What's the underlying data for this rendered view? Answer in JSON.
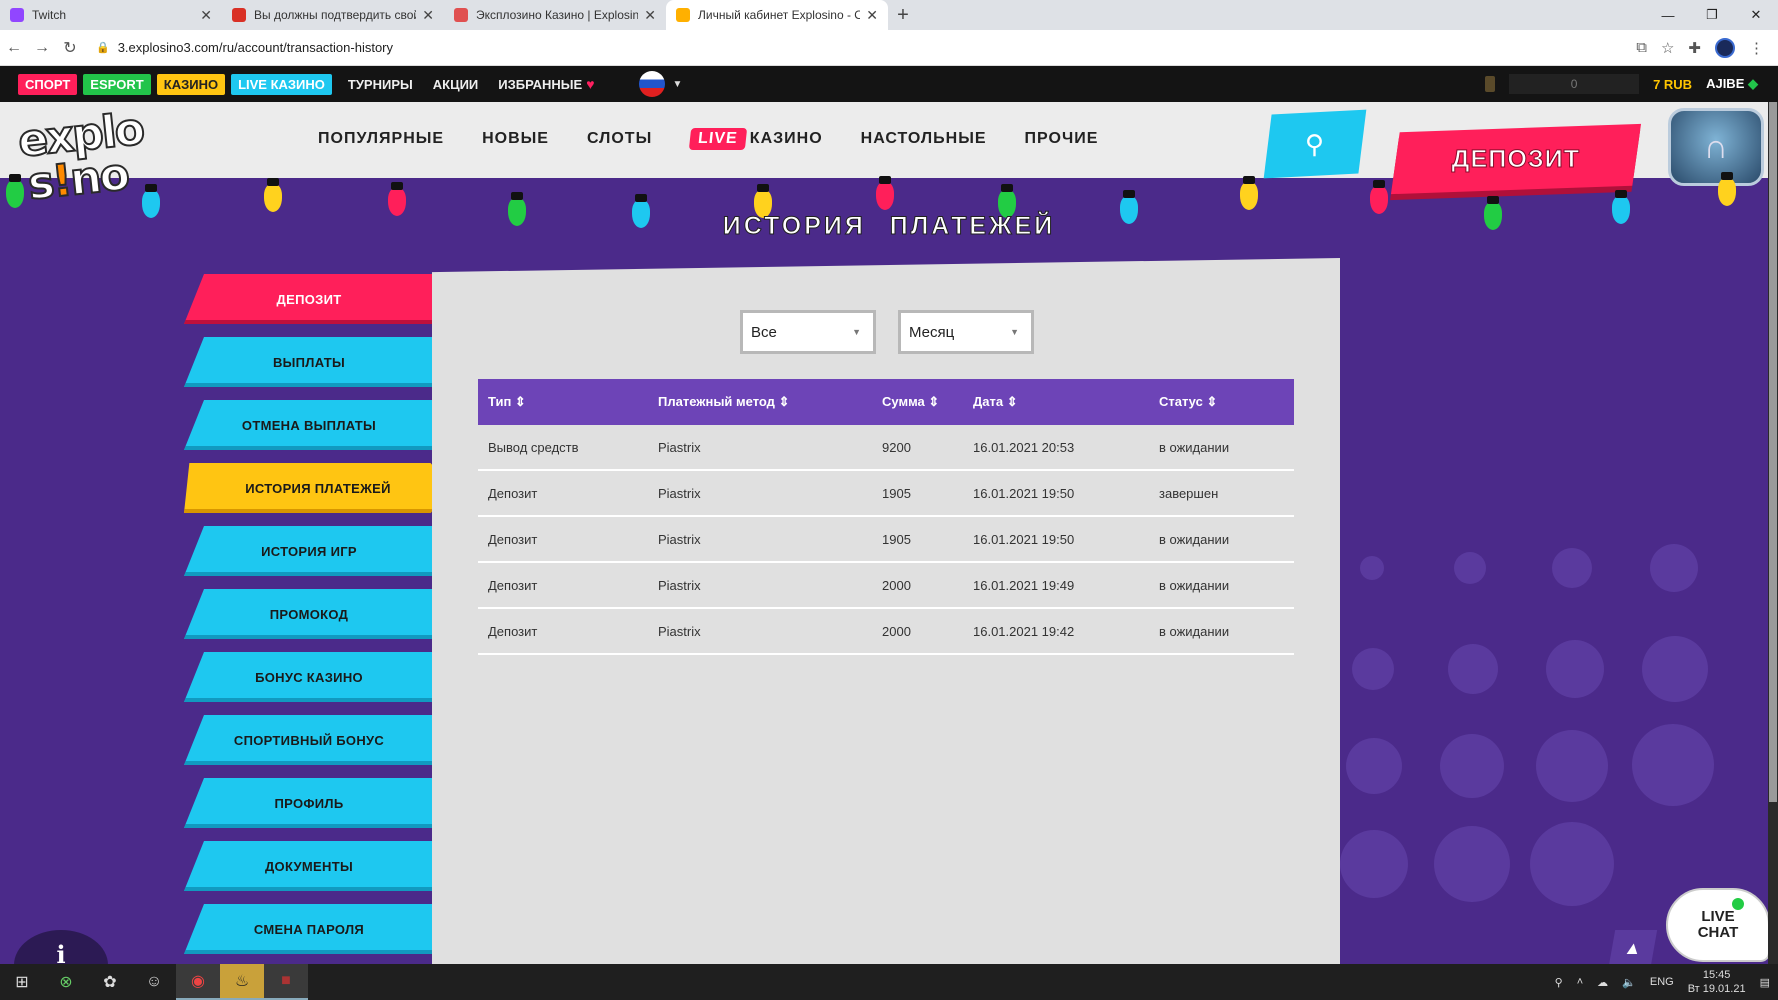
{
  "browser": {
    "tabs": [
      {
        "title": "Twitch",
        "color": "#9146ff",
        "active": false
      },
      {
        "title": "Вы должны подтвердить свой а",
        "color": "#d93025",
        "active": false
      },
      {
        "title": "Эксплозино Казино | Explosino с",
        "color": "#e05050",
        "active": false
      },
      {
        "title": "Личный кабинет Explosino - Onl",
        "color": "#ffb000",
        "active": true
      }
    ],
    "new_tab": "+",
    "url": "3.explosino3.com/ru/account/transaction-history"
  },
  "sitebar": {
    "sport": "СПОРТ",
    "esport": "ESPORT",
    "casino": "КАЗИНО",
    "live_casino": "LIVE КАЗИНО",
    "tournaments": "ТУРНИРЫ",
    "promotions": "АКЦИИ",
    "favorites": "ИЗБРАННЫЕ",
    "balance_box": "0",
    "balance": "7 RUB",
    "user": "AJIBE"
  },
  "header": {
    "logo_top": "explo",
    "logo_bottom_a": "s",
    "logo_bottom_b": "!",
    "logo_bottom_c": "no",
    "nav": {
      "popular": "ПОПУЛЯРНЫЕ",
      "new": "НОВЫЕ",
      "slots": "СЛОТЫ",
      "live_tag": "LIVE",
      "live_casino": "КАЗИНО",
      "table": "НАСТОЛЬНЫЕ",
      "other": "ПРОЧИЕ"
    },
    "deposit_button": "ДЕПОЗИТ"
  },
  "page_title": "ИСТОРИЯ ПЛАТЕЖЕЙ",
  "sidemenu": [
    {
      "label": "ДЕПОЗИТ"
    },
    {
      "label": "ВЫПЛАТЫ"
    },
    {
      "label": "ОТМЕНА ВЫПЛАТЫ"
    },
    {
      "label": "ИСТОРИЯ ПЛАТЕЖЕЙ"
    },
    {
      "label": "ИСТОРИЯ ИГР"
    },
    {
      "label": "ПРОМОКОД"
    },
    {
      "label": "БОНУС КАЗИНО"
    },
    {
      "label": "СПОРТИВНЫЙ БОНУС"
    },
    {
      "label": "ПРОФИЛЬ"
    },
    {
      "label": "ДОКУМЕНТЫ"
    },
    {
      "label": "СМЕНА ПАРОЛЯ"
    }
  ],
  "filters": {
    "type": "Все",
    "period": "Месяц"
  },
  "table": {
    "headers": [
      "Тип",
      "Платежный метод",
      "Сумма",
      "Дата",
      "Статус"
    ],
    "sort_glyph": "⇕",
    "rows": [
      [
        "Вывод средств",
        "Piastrix",
        "9200",
        "16.01.2021 20:53",
        "в ожидании"
      ],
      [
        "Депозит",
        "Piastrix",
        "1905",
        "16.01.2021 19:50",
        "завершен"
      ],
      [
        "Депозит",
        "Piastrix",
        "1905",
        "16.01.2021 19:50",
        "в ожидании"
      ],
      [
        "Депозит",
        "Piastrix",
        "2000",
        "16.01.2021 19:49",
        "в ожидании"
      ],
      [
        "Депозит",
        "Piastrix",
        "2000",
        "16.01.2021 19:42",
        "в ожидании"
      ]
    ]
  },
  "live_chat": {
    "line1": "LIVE",
    "line2": "CHAT"
  },
  "info_glyph": "i",
  "taskbar": {
    "lang": "ENG",
    "time": "15:45",
    "date": "Вт 19.01.21"
  },
  "colors": {
    "accent_pink": "#ff1f5a",
    "accent_cyan": "#1ec8f0",
    "accent_yellow": "#ffc512",
    "purple": "#6d44b7"
  }
}
